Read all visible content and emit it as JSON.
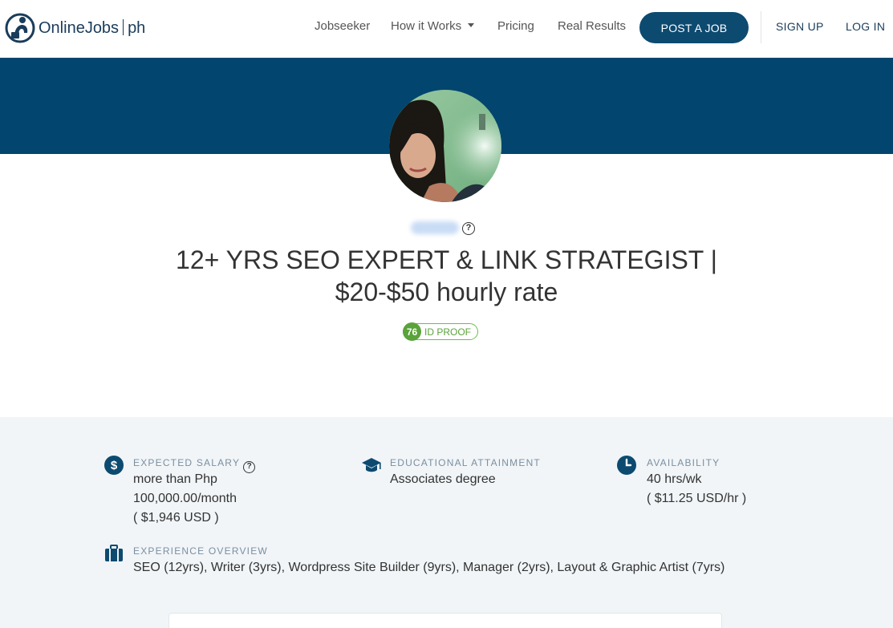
{
  "brand": {
    "name": "OnlineJobs",
    "suffix": "ph"
  },
  "nav": {
    "links": [
      "Jobseeker",
      "How it Works",
      "Pricing",
      "Real Results"
    ],
    "post_job": "POST A JOB",
    "sign_up": "SIGN UP",
    "log_in": "LOG IN"
  },
  "profile": {
    "headline_line1": "12+ YRS SEO EXPERT & LINK STRATEGIST |",
    "headline_line2": "$20-$50 hourly rate",
    "help_icon": "?",
    "id_score": "76",
    "id_label": "ID PROOF"
  },
  "details": {
    "salary": {
      "label": "EXPECTED SALARY",
      "line1": "more than Php",
      "line2": "100,000.00/month",
      "line3": "( $1,946 USD )",
      "icon_glyph": "$",
      "help_icon": "?"
    },
    "education": {
      "label": "EDUCATIONAL ATTAINMENT",
      "value": "Associates degree"
    },
    "availability": {
      "label": "AVAILABILITY",
      "line1": "40 hrs/wk",
      "line2": "( $11.25 USD/hr )"
    },
    "experience": {
      "label": "EXPERIENCE OVERVIEW",
      "value": "SEO (12yrs), Writer (3yrs), Wordpress Site Builder (9yrs), Manager (2yrs), Layout & Graphic Artist (7yrs)"
    }
  },
  "colors": {
    "brand_navy": "#02466f",
    "button_navy": "#0d4a70",
    "id_green": "#5aa33a",
    "details_bg": "#f1f5f8"
  },
  "icons": [
    "person-logo-icon",
    "caret-down-icon",
    "help-icon",
    "dollar-icon",
    "graduation-cap-icon",
    "clock-icon",
    "briefcase-icon"
  ]
}
